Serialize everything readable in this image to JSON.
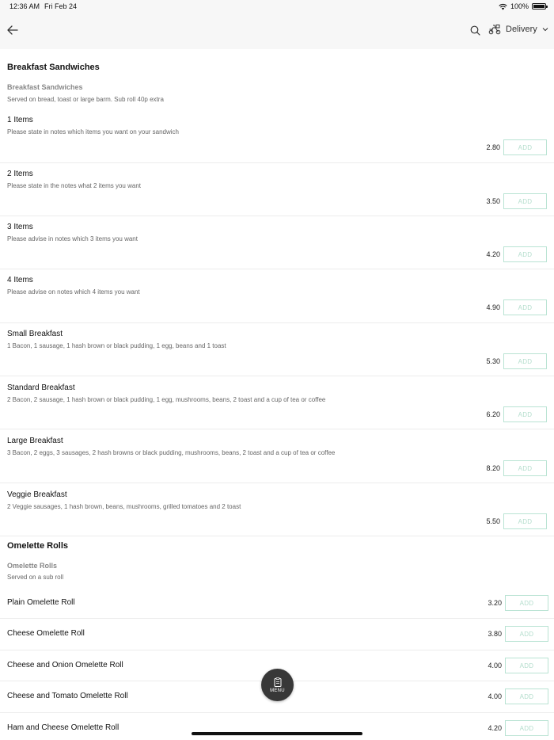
{
  "status_bar": {
    "time": "12:36 AM",
    "date": "Fri Feb 24",
    "battery": "100%",
    "battery_level": 1.0
  },
  "nav": {
    "back_icon": "arrow-left-icon",
    "search_icon": "search-icon",
    "delivery_icon": "scooter-icon",
    "delivery_label": "Delivery",
    "chevron_icon": "chevron-down-icon"
  },
  "sections": [
    {
      "title": "Breakfast Sandwiches",
      "subtitle": "Breakfast Sandwiches",
      "description": "Served on bread, toast or large barm. Sub roll 40p extra",
      "items": [
        {
          "name": "1 Items",
          "description": "Please state in notes which items you want on your sandwich",
          "price": "2.80",
          "add_label": "ADD"
        },
        {
          "name": "2 Items",
          "description": "Please state in the notes what 2 items you want",
          "price": "3.50",
          "add_label": "ADD"
        },
        {
          "name": "3 Items",
          "description": "Please advise in notes which 3 items you want",
          "price": "4.20",
          "add_label": "ADD"
        },
        {
          "name": "4 Items",
          "description": "Please advise on notes which 4 items you want",
          "price": "4.90",
          "add_label": "ADD"
        },
        {
          "name": "Small Breakfast",
          "description": "1 Bacon, 1 sausage, 1 hash brown or black pudding, 1 egg, beans and 1 toast",
          "price": "5.30",
          "add_label": "ADD"
        },
        {
          "name": "Standard Breakfast",
          "description": "2 Bacon, 2 sausage, 1 hash brown or black pudding, 1 egg, mushrooms, beans, 2 toast and a cup of tea or coffee",
          "price": "6.20",
          "add_label": "ADD"
        },
        {
          "name": "Large Breakfast",
          "description": "3 Bacon, 2 eggs, 3 sausages, 2 hash browns or black pudding, mushrooms, beans, 2 toast and a cup of tea or coffee",
          "price": "8.20",
          "add_label": "ADD"
        },
        {
          "name": "Veggie Breakfast",
          "description": "2 Veggie sausages, 1 hash brown, beans, mushrooms, grilled tomatoes and 2 toast",
          "price": "5.50",
          "add_label": "ADD"
        }
      ]
    },
    {
      "title": "Omelette Rolls",
      "subtitle": "Omelette Rolls",
      "description": "Served on a sub roll",
      "items": [
        {
          "name": "Plain Omelette Roll",
          "price": "3.20",
          "add_label": "ADD"
        },
        {
          "name": "Cheese Omelette Roll",
          "price": "3.80",
          "add_label": "ADD"
        },
        {
          "name": "Cheese and Onion Omelette Roll",
          "price": "4.00",
          "add_label": "ADD"
        },
        {
          "name": "Cheese and Tomato Omelette Roll",
          "price": "4.00",
          "add_label": "ADD"
        },
        {
          "name": "Ham and Cheese Omelette Roll",
          "price": "4.20",
          "add_label": "ADD"
        }
      ]
    }
  ],
  "menu_button": {
    "label": "MENU",
    "icon": "clipboard-icon"
  },
  "colors": {
    "add_border": "#b9e3d3",
    "add_text": "#b3ddcc",
    "nav_bg": "#f7f7f7",
    "fab_bg": "#383838"
  }
}
